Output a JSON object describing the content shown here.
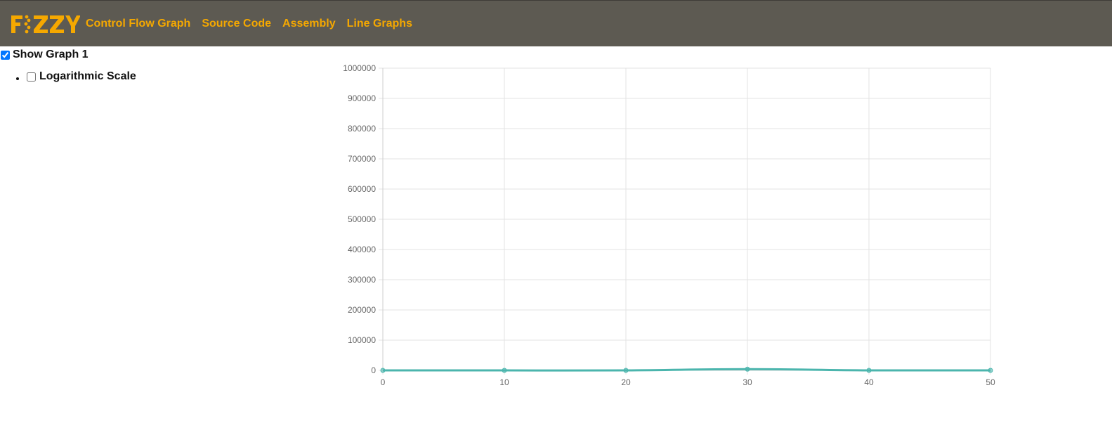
{
  "navbar": {
    "logo_text": "FIZZY",
    "links": [
      {
        "label": "Control Flow Graph"
      },
      {
        "label": "Source Code"
      },
      {
        "label": "Assembly"
      },
      {
        "label": "Line Graphs"
      }
    ],
    "bg_color": "#5d5a52",
    "accent_color": "#f5a800"
  },
  "controls": {
    "show_graph_label": "Show Graph 1",
    "show_graph_checked": true,
    "log_scale_label": "Logarithmic Scale",
    "log_scale_checked": false
  },
  "chart_data": {
    "type": "line",
    "x": [
      0,
      10,
      20,
      30,
      40,
      50
    ],
    "series": [
      {
        "values": [
          0,
          0,
          0,
          4000,
          0,
          0
        ],
        "color": "#4bb5ad"
      }
    ],
    "xlim": [
      0,
      50
    ],
    "ylim": [
      0,
      1000000
    ],
    "xticks": [
      0,
      10,
      20,
      30,
      40,
      50
    ],
    "yticks": [
      0,
      100000,
      200000,
      300000,
      400000,
      500000,
      600000,
      700000,
      800000,
      900000,
      1000000
    ],
    "grid": true,
    "title": "",
    "xlabel": "",
    "ylabel": ""
  }
}
